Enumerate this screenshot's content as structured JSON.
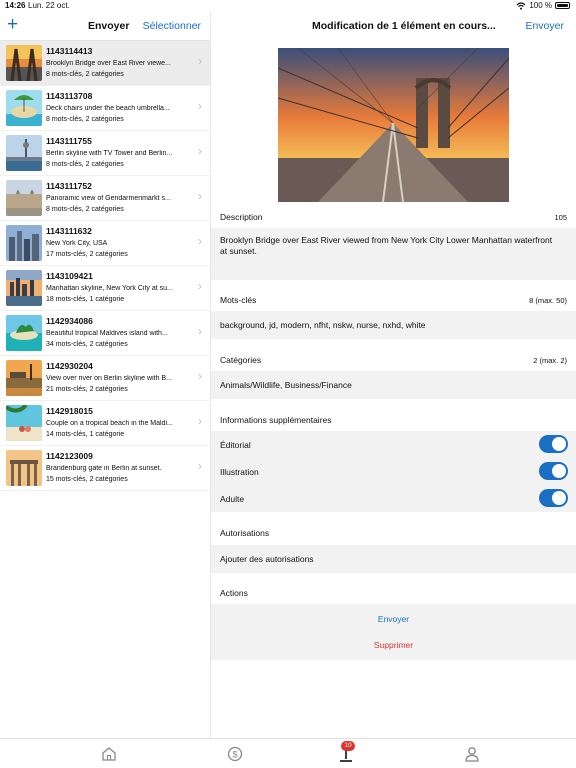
{
  "status_bar": {
    "time": "14:26",
    "date": "Lun. 22 oct.",
    "battery": "100 %"
  },
  "left_nav": {
    "title": "Envoyer",
    "select_label": "Sélectionner",
    "add_icon": "plus-icon"
  },
  "items": [
    {
      "id": "1143114413",
      "desc": "Brooklyn Bridge over East River viewe...",
      "meta": "8 mots-clés, 2 catégories"
    },
    {
      "id": "1143113708",
      "desc": "Deck chairs under the beach umbrella...",
      "meta": "8 mots-clés, 2 catégories"
    },
    {
      "id": "1143111755",
      "desc": "Berlin skyline with TV Tower and Berlin...",
      "meta": "8 mots-clés, 2 catégories"
    },
    {
      "id": "1143111752",
      "desc": "Panoramic view of Gendarmenmarkt s...",
      "meta": "8 mots-clés, 2 catégories"
    },
    {
      "id": "1143111632",
      "desc": "New York City, USA",
      "meta": "17 mots-clés, 2 catégories"
    },
    {
      "id": "1143109421",
      "desc": "Manhattan skyline, New York City at su...",
      "meta": "18 mots-clés, 1 catégorie"
    },
    {
      "id": "1142934086",
      "desc": "Beautiful tropical Maldives island with...",
      "meta": "34 mots-clés, 2 catégories"
    },
    {
      "id": "1142930204",
      "desc": "View over river on Berlin skyline with B...",
      "meta": "21 mots-clés, 2 catégories"
    },
    {
      "id": "1142918015",
      "desc": "Couple on a tropical beach in the Maldi...",
      "meta": "14 mots-clés, 1 catégorie"
    },
    {
      "id": "1142123009",
      "desc": "Brandenburg gate in Berlin at sunset.",
      "meta": "15 mots-clés, 2 catégories"
    }
  ],
  "right_nav": {
    "title": "Modification de 1 élément en cours...",
    "send_label": "Envoyer"
  },
  "description": {
    "label": "Description",
    "count": "105",
    "text_line1": "Brooklyn Bridge over East River viewed from New York City Lower Manhattan waterfront",
    "text_line2": "at sunset."
  },
  "keywords": {
    "label": "Mots-clés",
    "count": "8 (max. 50)",
    "value": "background, jd, modern, nfht, nskw, nurse, nxhd, white"
  },
  "categories": {
    "label": "Catégories",
    "count": "2 (max. 2)",
    "value": "Animals/Wildlife, Business/Finance"
  },
  "extra": {
    "label": "Informations supplémentaires",
    "toggles": [
      {
        "label": "Éditorial",
        "on": true
      },
      {
        "label": "Illustration",
        "on": true
      },
      {
        "label": "Adulte",
        "on": true
      }
    ]
  },
  "permissions": {
    "label": "Autorisations",
    "add": "Ajouter des autorisations"
  },
  "actions": {
    "label": "Actions",
    "send": "Envoyer",
    "delete": "Supprimer"
  },
  "tabbar": {
    "upload_badge": "10",
    "tabs": [
      "home-icon",
      "dollar-icon",
      "upload-icon",
      "profile-icon"
    ]
  },
  "colors": {
    "accent": "#1a6fc4",
    "danger": "#e0312c"
  }
}
